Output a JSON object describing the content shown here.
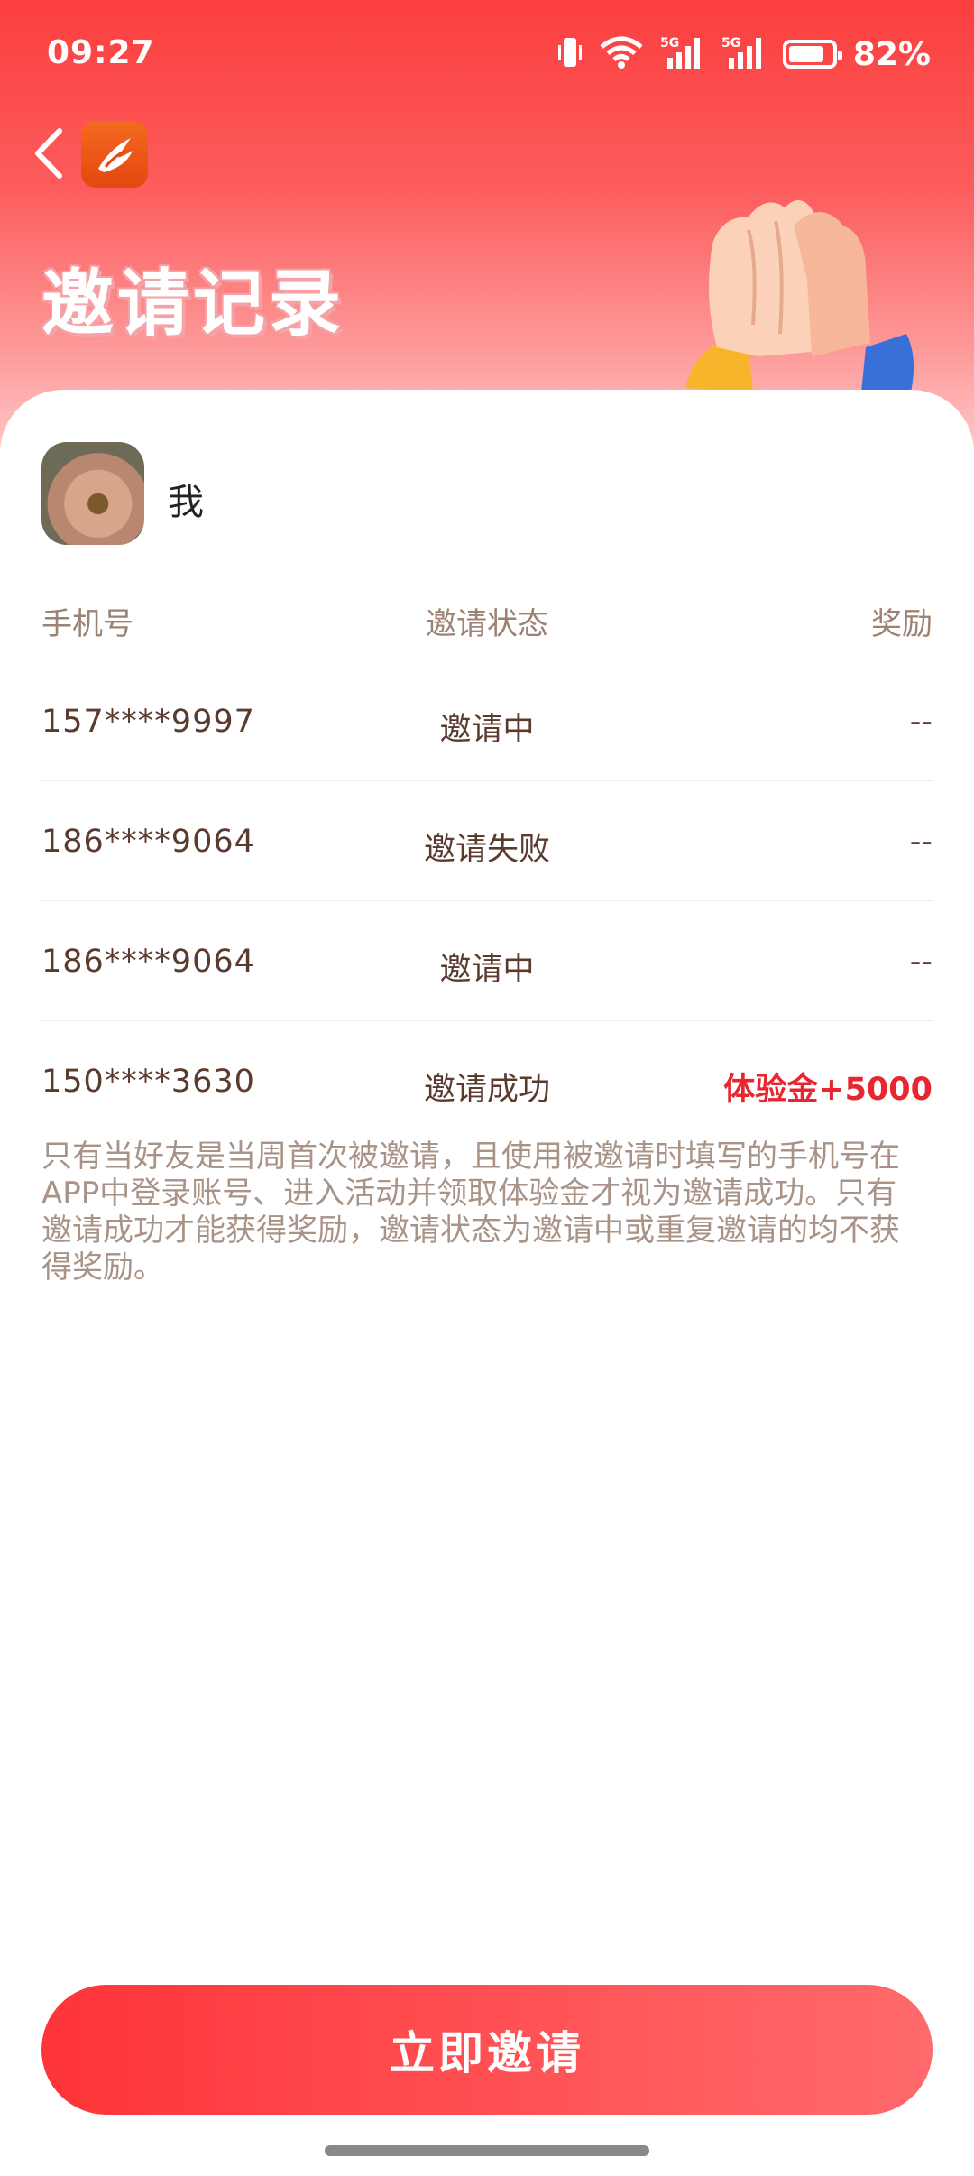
{
  "status_bar": {
    "time": "09:27",
    "battery_percent": "82%",
    "battery_level": 0.82,
    "network_1": "5G",
    "network_2": "5G"
  },
  "header": {
    "title": "邀请记录"
  },
  "user": {
    "name": "我"
  },
  "table": {
    "columns": [
      "手机号",
      "邀请状态",
      "奖励"
    ],
    "rows": [
      {
        "phone": "157****9997",
        "status": "邀请中",
        "reward": "--"
      },
      {
        "phone": "186****9064",
        "status": "邀请失败",
        "reward": "--"
      },
      {
        "phone": "186****9064",
        "status": "邀请中",
        "reward": "--"
      },
      {
        "phone": "150****3630",
        "status": "邀请成功",
        "reward": "体验金+5000"
      }
    ]
  },
  "notice": {
    "lines": [
      "只有当好友是当周首次被邀请，且使用被邀请时填写的手机号在",
      "APP中登录账号、进入活动并领取体验金才视为邀请成功。只有",
      "邀请成功才能获得奖励，邀请状态为邀请中或重复邀请的均不获",
      "得奖励。"
    ]
  },
  "footer": {
    "invite_button": "立即邀请"
  },
  "colors": {
    "brand_red": "#fe3438",
    "reward_red": "#e8262f",
    "text_brown": "#5a3b2e",
    "muted": "#a89386"
  }
}
